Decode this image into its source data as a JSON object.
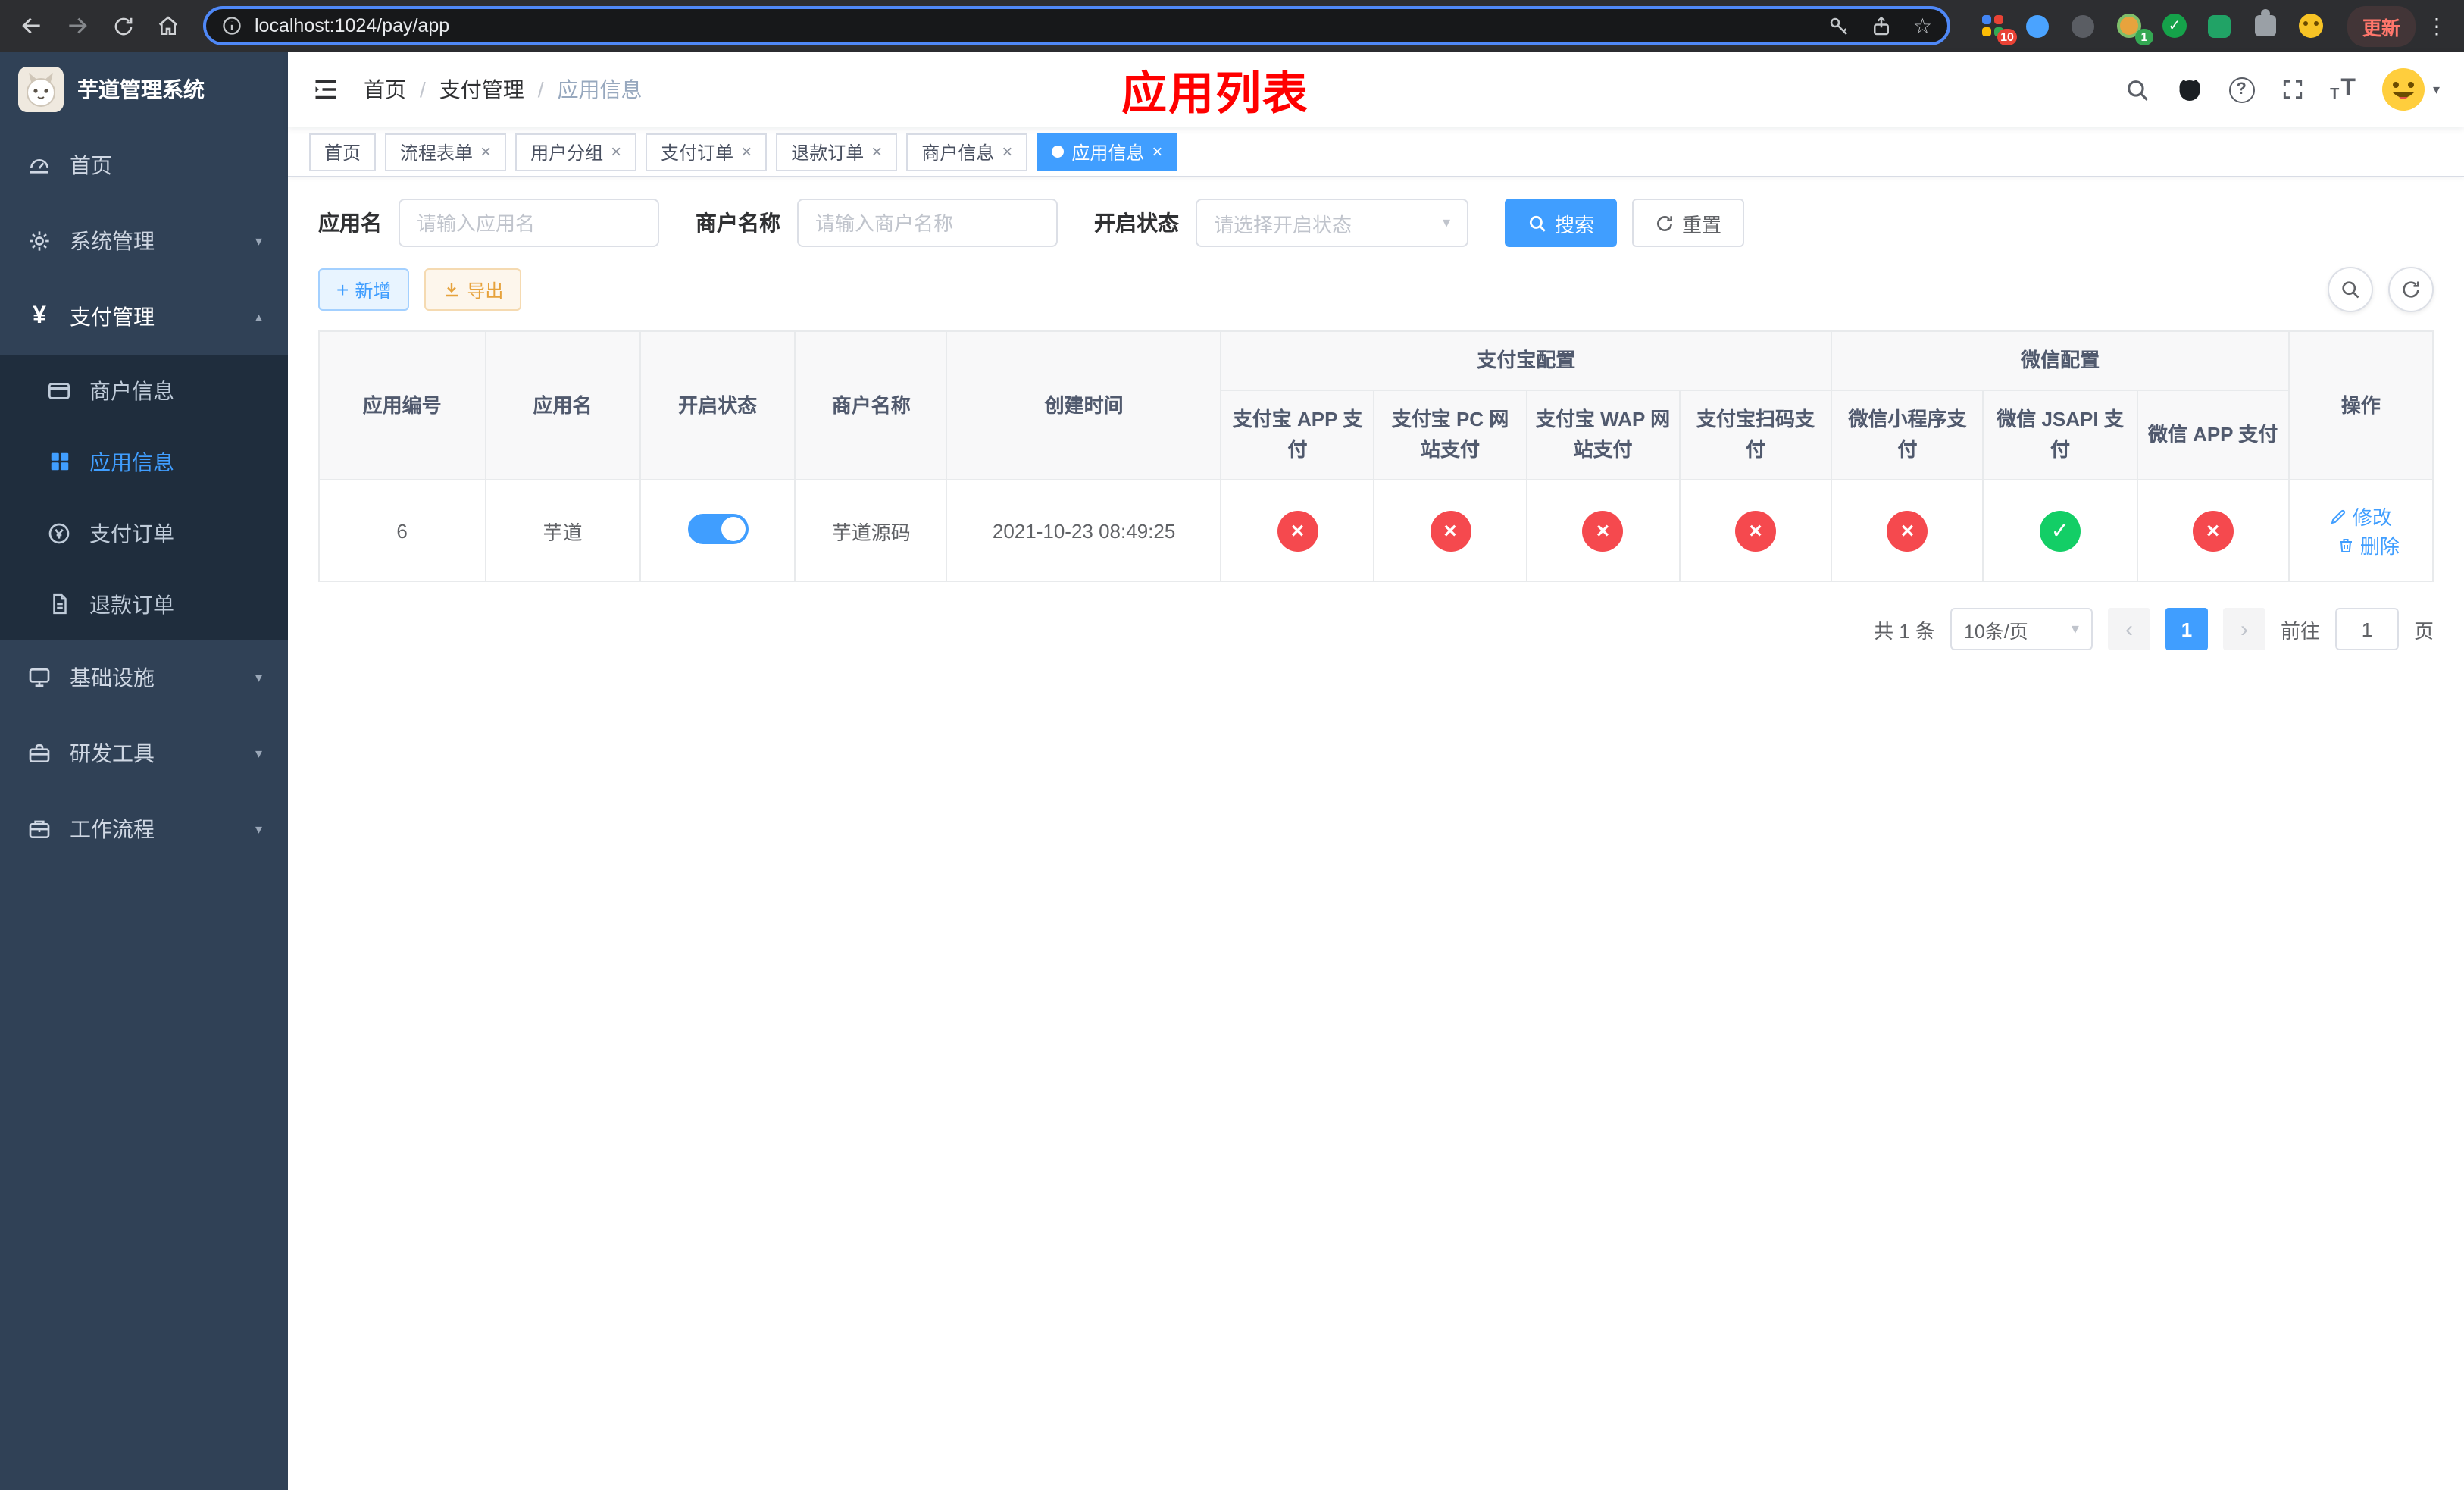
{
  "browser": {
    "url": "localhost:1024/pay/app",
    "update_label": "更新",
    "ext_badge_grid": "10",
    "ext_badge_profile": "1"
  },
  "sidebar": {
    "title": "芋道管理系统",
    "menu": [
      {
        "label": "首页"
      },
      {
        "label": "系统管理"
      },
      {
        "label": "支付管理"
      },
      {
        "label": "基础设施"
      },
      {
        "label": "研发工具"
      },
      {
        "label": "工作流程"
      }
    ],
    "pay_submenu": [
      {
        "label": "商户信息"
      },
      {
        "label": "应用信息"
      },
      {
        "label": "支付订单"
      },
      {
        "label": "退款订单"
      }
    ]
  },
  "navbar": {
    "breadcrumb": [
      "首页",
      "支付管理",
      "应用信息"
    ],
    "annotation": "应用列表"
  },
  "tags": [
    {
      "label": "首页"
    },
    {
      "label": "流程表单"
    },
    {
      "label": "用户分组"
    },
    {
      "label": "支付订单"
    },
    {
      "label": "退款订单"
    },
    {
      "label": "商户信息"
    },
    {
      "label": "应用信息"
    }
  ],
  "search": {
    "app_name_label": "应用名",
    "app_name_placeholder": "请输入应用名",
    "merchant_label": "商户名称",
    "merchant_placeholder": "请输入商户名称",
    "status_label": "开启状态",
    "status_placeholder": "请选择开启状态",
    "search_button": "搜索",
    "reset_button": "重置"
  },
  "toolbar": {
    "add_label": "新增",
    "export_label": "导出"
  },
  "table": {
    "headers": {
      "app_id": "应用编号",
      "app_name": "应用名",
      "status": "开启状态",
      "merchant": "商户名称",
      "created": "创建时间",
      "alipay_group": "支付宝配置",
      "wechat_group": "微信配置",
      "alipay_app": "支付宝 APP 支付",
      "alipay_pc": "支付宝 PC 网站支付",
      "alipay_wap": "支付宝 WAP 网站支付",
      "alipay_qr": "支付宝扫码支付",
      "wx_lite": "微信小程序支付",
      "wx_jsapi": "微信 JSAPI 支付",
      "wx_app": "微信 APP 支付",
      "actions": "操作"
    },
    "row": {
      "id": "6",
      "name": "芋道",
      "status_on": true,
      "merchant": "芋道源码",
      "created": "2021-10-23 08:49:25",
      "channels": {
        "alipay_app": false,
        "alipay_pc": false,
        "alipay_wap": false,
        "alipay_qr": false,
        "wx_lite": false,
        "wx_jsapi": true,
        "wx_app": false
      },
      "edit_label": "修改",
      "delete_label": "删除"
    }
  },
  "pagination": {
    "total_text": "共 1 条",
    "page_size_text": "10条/页",
    "current_page": "1",
    "goto_prefix": "前往",
    "goto_value": "1",
    "goto_suffix": "页"
  },
  "icons": {
    "close": "×",
    "cross": "×",
    "check": "✓",
    "caret_down": "▾",
    "caret_up": "▴",
    "prev": "‹",
    "next": "›",
    "kebab": "⋮",
    "star": "☆",
    "plus": "+",
    "question": "?"
  },
  "colors": {
    "primary": "#409eff",
    "success": "#13ce66",
    "danger": "#f5494e",
    "warning": "#e6a23c",
    "annotation_red": "#ff0000",
    "sidebar_bg": "#304156",
    "submenu_bg": "#1f2d3d",
    "active_tag_bg": "#409eff"
  }
}
